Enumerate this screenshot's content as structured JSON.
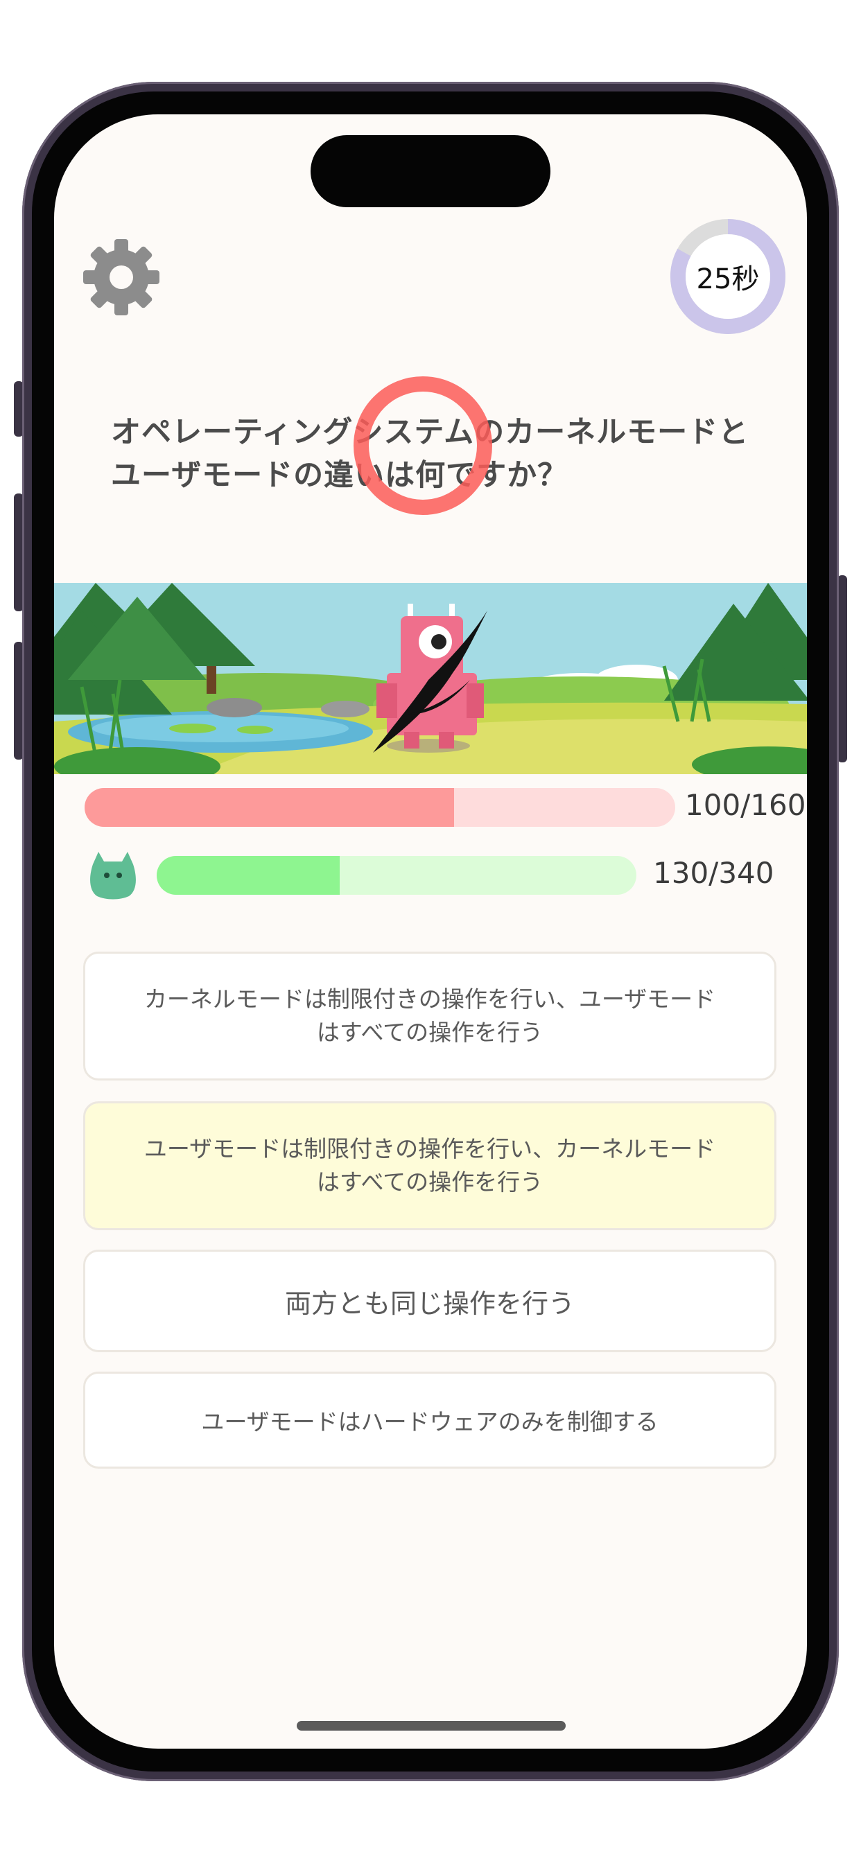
{
  "header": {
    "settings_icon": "gear-icon",
    "timer_label": "25秒",
    "timer_remaining_fraction": 0.83,
    "timer_color": "#cbc5ea",
    "timer_track_color": "#dcdcdc"
  },
  "question": {
    "line1": "オペレーティングシステムのカーネルモードと",
    "line2": "ユーザモードの違いは何ですか？"
  },
  "feedback": {
    "mark": "wrong-circle-icon",
    "color": "#fc5c58"
  },
  "battle": {
    "enemy_icon": "pink-cyclops-monster-icon",
    "enemy_hp_text": "100/160",
    "enemy_hp_fraction": 0.625,
    "enemy_hp_color": "#fd9a9a",
    "enemy_hp_track": "#fedcdc",
    "player_icon": "green-slime-icon",
    "player_hp_text": "130/340",
    "player_hp_fraction": 0.382,
    "player_hp_color": "#8ef590",
    "player_hp_track": "#dcfcd8"
  },
  "answers": [
    {
      "line1": "カーネルモードは制限付きの操作を行い、ユーザモード",
      "line2": "はすべての操作を行う",
      "highlight": false
    },
    {
      "line1": "ユーザモードは制限付きの操作を行い、カーネルモード",
      "line2": "はすべての操作を行う",
      "highlight": true,
      "highlight_color": "#fefcd9"
    },
    {
      "line1": "両方とも同じ操作を行う"
    },
    {
      "line1": "ユーザモードはハードウェアのみを制御する"
    }
  ]
}
